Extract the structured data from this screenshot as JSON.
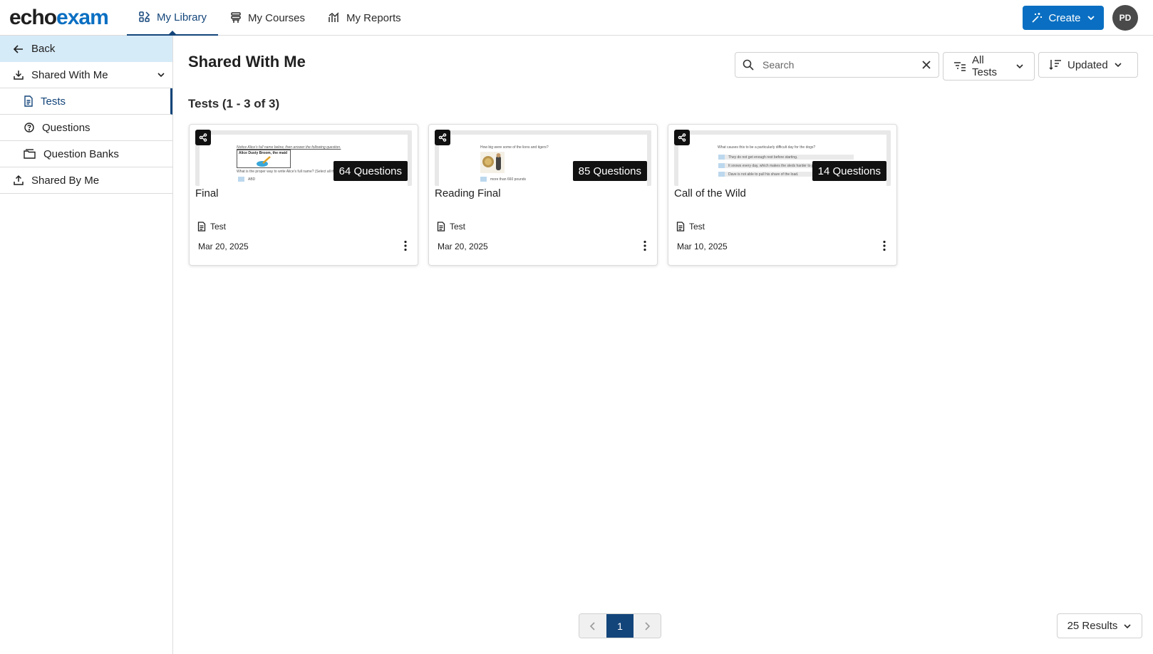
{
  "app": {
    "logo_part1": "echo",
    "logo_part2": "exam",
    "brand_color": "#0a6fc2",
    "accent_color": "#13457a"
  },
  "topnav": {
    "tabs": [
      {
        "label": "My Library",
        "icon": "library-icon",
        "active": true
      },
      {
        "label": "My Courses",
        "icon": "courses-icon",
        "active": false
      },
      {
        "label": "My Reports",
        "icon": "reports-icon",
        "active": false
      }
    ],
    "create_label": "Create",
    "avatar_initials": "PD"
  },
  "sidebar": {
    "back_label": "Back",
    "shared_with_me_label": "Shared With Me",
    "items": [
      {
        "label": "Tests",
        "icon": "test-doc-icon",
        "active": true
      },
      {
        "label": "Questions",
        "icon": "question-icon",
        "active": false
      },
      {
        "label": "Question Banks",
        "icon": "question-bank-icon",
        "active": false
      }
    ],
    "shared_by_me_label": "Shared By Me"
  },
  "main": {
    "title": "Shared With Me",
    "search_placeholder": "Search",
    "filter_label": "All Tests",
    "sort_label": "Updated",
    "section_title": "Tests (1 - 3 of 3)"
  },
  "cards": [
    {
      "title": "Final",
      "question_count": "64 Questions",
      "type": "Test",
      "date": "Mar 20, 2025",
      "thumb_lines": [
        "Notice Alice's full name below, then answer the following question.",
        "Alice Dusty Broom, the maid",
        "What is the proper way to write Alice's full name?  (Select all the",
        "ABD"
      ]
    },
    {
      "title": "Reading Final",
      "question_count": "85 Questions",
      "type": "Test",
      "date": "Mar 20, 2025",
      "thumb_lines": [
        "How big were some of the lions and tigers?",
        "more than 660 pounds"
      ]
    },
    {
      "title": "Call of the Wild",
      "question_count": "14 Questions",
      "type": "Test",
      "date": "Mar 10, 2025",
      "thumb_lines": [
        "What causes this to be a particularly difficult day for the dogs?",
        "They do not get enough rest before starting.",
        "It snows every day, which makes the sleds harder to pull.",
        "Dave is not able to pull his share of the load."
      ]
    }
  ],
  "pagination": {
    "current_page": "1",
    "results_label": "25 Results"
  }
}
